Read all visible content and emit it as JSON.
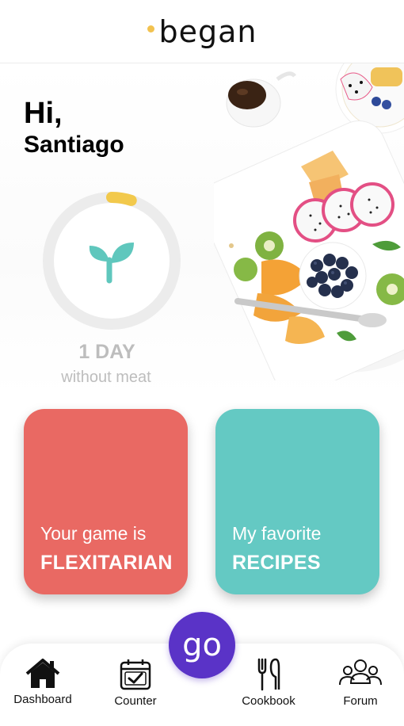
{
  "header": {
    "logo_text": "began"
  },
  "greeting": {
    "hi": "Hi,",
    "name": "Santiago"
  },
  "counter": {
    "value": "1 DAY",
    "caption": "without meat",
    "progress": 0.05,
    "progress_color": "#f2c94c",
    "icon": "sprout-icon"
  },
  "cards": [
    {
      "subtitle": "Your game is",
      "title": "FLEXITARIAN",
      "color": "#e96963"
    },
    {
      "subtitle": "My favorite",
      "title": "RECIPES",
      "color": "#64c9c3"
    }
  ],
  "go_button": {
    "label": "go",
    "color": "#5a33c7"
  },
  "nav": [
    {
      "label": "Dashboard",
      "icon": "home-icon"
    },
    {
      "label": "Counter",
      "icon": "calendar-check-icon"
    },
    {
      "label": "Cookbook",
      "icon": "cutlery-icon"
    },
    {
      "label": "Forum",
      "icon": "group-icon"
    }
  ],
  "colors": {
    "accent": "#5a33c7",
    "teal": "#64c9c3",
    "coral": "#e96963",
    "logo_dot": "#f2c24f"
  }
}
